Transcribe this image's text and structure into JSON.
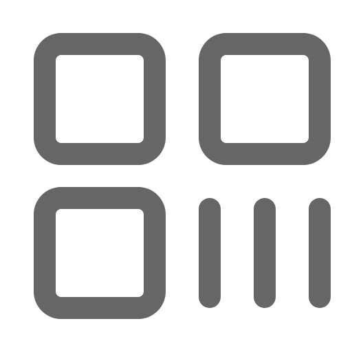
{
  "icon": {
    "name": "qr-code-scan-icon",
    "color": "#666666",
    "background": "#ffffff"
  }
}
